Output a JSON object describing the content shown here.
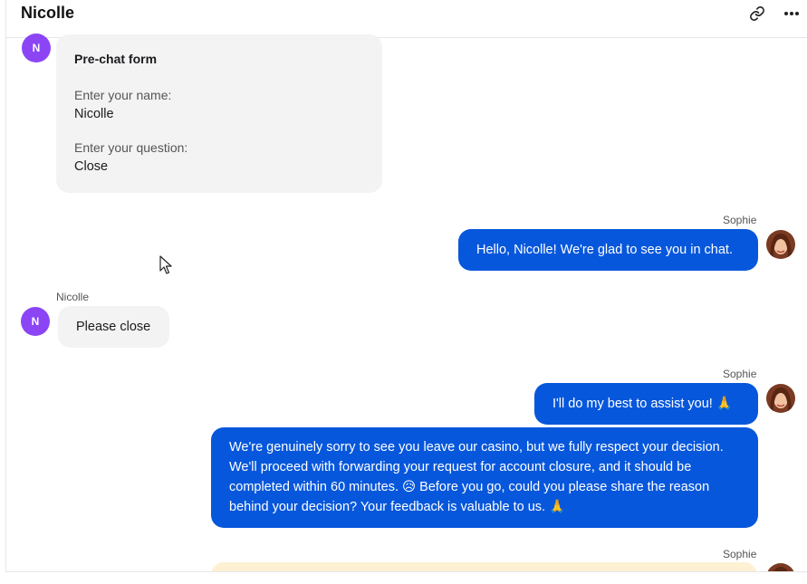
{
  "header": {
    "title": "Nicolle",
    "link_icon": "link-icon",
    "more_icon": "more-horizontal-icon"
  },
  "visitor": {
    "initial": "N",
    "name": "Nicolle",
    "avatar_color": "#8b45f5"
  },
  "agent": {
    "name": "Sophie",
    "avatar_icon": "agent-photo-avatar"
  },
  "prechat_form": {
    "title": "Pre-chat form",
    "name_label": "Enter your name:",
    "name_value": "Nicolle",
    "question_label": "Enter your question:",
    "question_value": "Close"
  },
  "messages": [
    {
      "sender": "Sophie",
      "text": "Hello, Nicolle! We're glad to see you in chat."
    },
    {
      "sender": "Nicolle",
      "text": "Please close"
    },
    {
      "sender": "Sophie",
      "text": "I'll do my best to assist you! 🙏"
    },
    {
      "sender": "Sophie",
      "text": "We're genuinely sorry to see you leave our casino, but we fully respect your decision. We'll proceed with forwarding your request for account closure, and it should be completed within 60 minutes. 😥 Before you go, could you please share the reason behind your decision? Your feedback is valuable to us. 🙏"
    },
    {
      "sender": "Sophie",
      "text": ""
    }
  ],
  "colors": {
    "agent_bubble": "#0757dc",
    "visitor_bubble": "#f3f3f3",
    "pending_bubble": "#fdf0d3"
  }
}
